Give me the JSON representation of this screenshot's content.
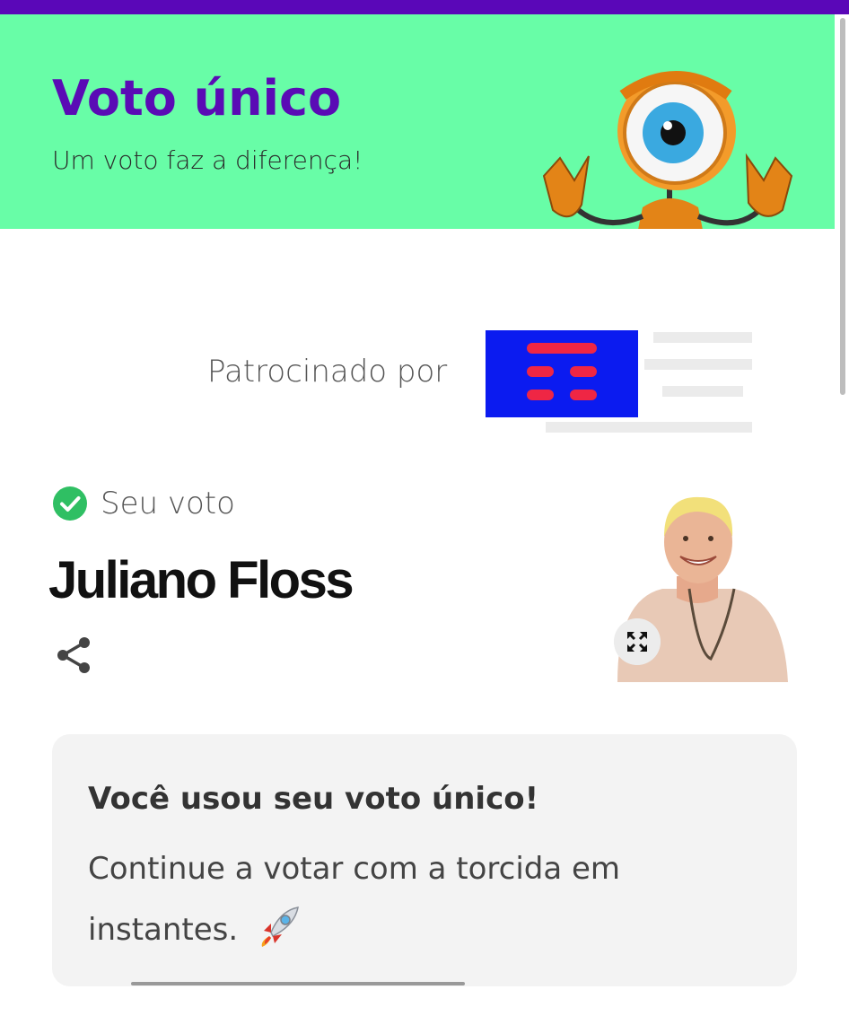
{
  "header": {
    "title": "Voto único",
    "subtitle": "Um voto faz a diferença!",
    "mascot_icon": "big-brother-eye-mascot"
  },
  "sponsor": {
    "label": "Patrocinado por",
    "logo_icon": "sponsor-logo-tim"
  },
  "vote": {
    "status_label": "Seu voto",
    "status_icon": "check-circle-icon",
    "candidate_name": "Juliano Floss",
    "share_icon": "share-icon",
    "expand_icon": "expand-icon"
  },
  "info": {
    "title": "Você usou seu voto único!",
    "message": "Continue a votar com a torcida em instantes.",
    "emoji_icon": "rocket-icon"
  },
  "colors": {
    "accent_purple": "#5a07b8",
    "header_green": "#68fda7",
    "check_green": "#2fbf63",
    "sponsor_blue": "#0b1bf0",
    "sponsor_red": "#ef2644"
  }
}
